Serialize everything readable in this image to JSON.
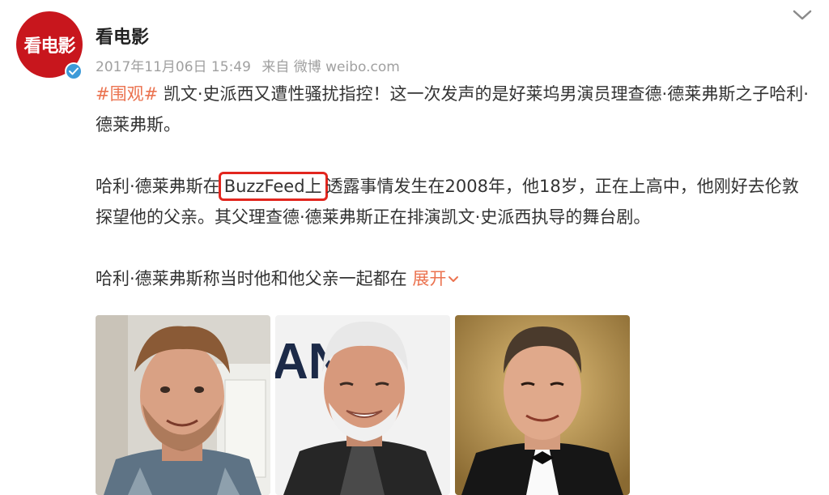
{
  "account": {
    "avatar_text": "看电影",
    "name": "看电影",
    "timestamp": "2017年11月06日 15:49",
    "source": "来自 微博 weibo.com"
  },
  "post": {
    "topic": "#围观#",
    "para1_rest": " 凯文·史派西又遭性骚扰指控！这一次发声的是好莱坞男演员理查德·德莱弗斯之子哈利·德莱弗斯。",
    "para2_before": "哈利·德莱弗斯在",
    "para2_highlight": "BuzzFeed上",
    "para2_after": "透露事情发生在2008年，他18岁，正在上高中，他刚好去伦敦探望他的父亲。其父理查德·德莱弗斯正在排演凯文·史派西执导的舞台剧。",
    "para3": "哈利·德莱弗斯称当时他和他父亲一起都在 ",
    "expand_label": "展开"
  },
  "photos": [
    {
      "icon": "photo-young-man"
    },
    {
      "icon": "photo-older-man"
    },
    {
      "icon": "photo-man-in-tuxedo"
    }
  ],
  "colors": {
    "accent": "#eb7350",
    "highlight_border": "#e2261e",
    "avatar_bg": "#c8161d",
    "verified": "#3c9ad8"
  }
}
